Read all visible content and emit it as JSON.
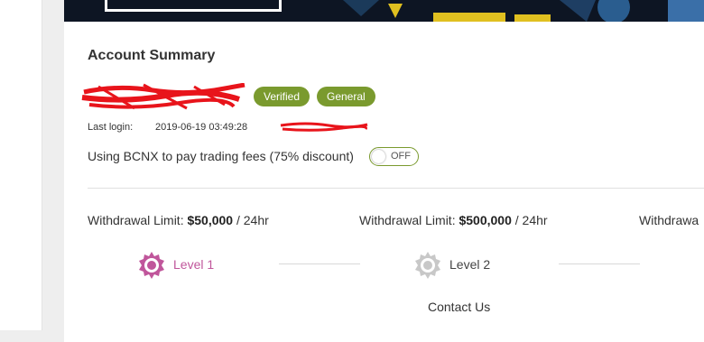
{
  "account_summary": {
    "title": "Account Summary",
    "badges": {
      "verified": "Verified",
      "general": "General"
    },
    "last_login": {
      "label": "Last login:",
      "time": "2019-06-19 03:49:28"
    },
    "fee_option": {
      "text": "Using BCNX to pay trading fees (75% discount)",
      "toggle_state": "OFF"
    }
  },
  "limits": [
    {
      "prefix": "Withdrawal Limit: ",
      "amount": "$50,000",
      "suffix": " / 24hr"
    },
    {
      "prefix": "Withdrawal Limit: ",
      "amount": "$500,000",
      "suffix": " / 24hr"
    },
    {
      "prefix": "Withdrawa"
    }
  ],
  "levels": [
    {
      "label": "Level 1",
      "status": "active"
    },
    {
      "label": "Level 2",
      "status": "inactive"
    }
  ],
  "contact_label": "Contact Us",
  "colors": {
    "badge_green": "#7a9a2e",
    "level_active": "#c0569b",
    "level_inactive": "#c8c8c8",
    "redaction": "#e8141b"
  },
  "icons": [
    "level-badge-icon",
    "toggle-switch"
  ]
}
